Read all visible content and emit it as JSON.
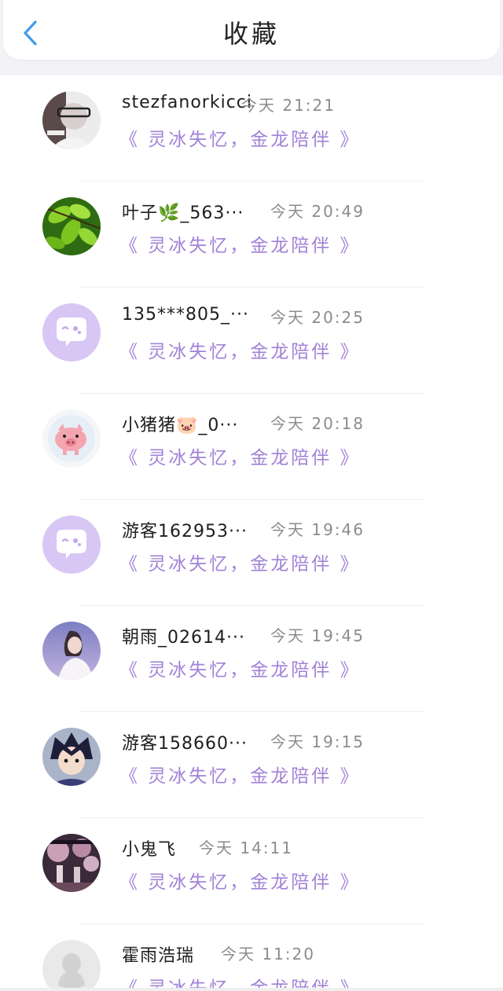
{
  "header": {
    "title": "收藏",
    "back_icon": "chevron-left-icon",
    "accent_color": "#3d9ce8"
  },
  "list": {
    "book_color": "#a182d6",
    "items": [
      {
        "name": "stezfanorkicci",
        "time": "今天 21:21",
        "book": "《 灵冰失忆，金龙陪伴 》",
        "avatar": "photo-avatar"
      },
      {
        "name": "叶子🌿_563···",
        "time": "今天 20:49",
        "book": "《 灵冰失忆，金龙陪伴 》",
        "avatar": "leaves-avatar"
      },
      {
        "name": "135***805_···",
        "time": "今天 20:25",
        "book": "《 灵冰失忆，金龙陪伴 》",
        "avatar": "default-chat-avatar"
      },
      {
        "name": "小猪猪🐷_0···",
        "time": "今天 20:18",
        "book": "《 灵冰失忆，金龙陪伴 》",
        "avatar": "pig-avatar"
      },
      {
        "name": "游客162953···",
        "time": "今天 19:46",
        "book": "《 灵冰失忆，金龙陪伴 》",
        "avatar": "default-chat-avatar"
      },
      {
        "name": "朝雨_02614···",
        "time": "今天 19:45",
        "book": "《 灵冰失忆，金龙陪伴 》",
        "avatar": "girl-photo-avatar"
      },
      {
        "name": "游客158660···",
        "time": "今天 19:15",
        "book": "《 灵冰失忆，金龙陪伴 》",
        "avatar": "anime-avatar"
      },
      {
        "name": "小鬼飞",
        "time": "今天 14:11",
        "book": "《 灵冰失忆，金龙陪伴 》",
        "avatar": "scene-avatar"
      },
      {
        "name": "霍雨浩瑞",
        "time": "今天 11:20",
        "book": "《 灵冰失忆，金龙陪伴 》",
        "avatar": "default-penguin-avatar"
      }
    ]
  }
}
